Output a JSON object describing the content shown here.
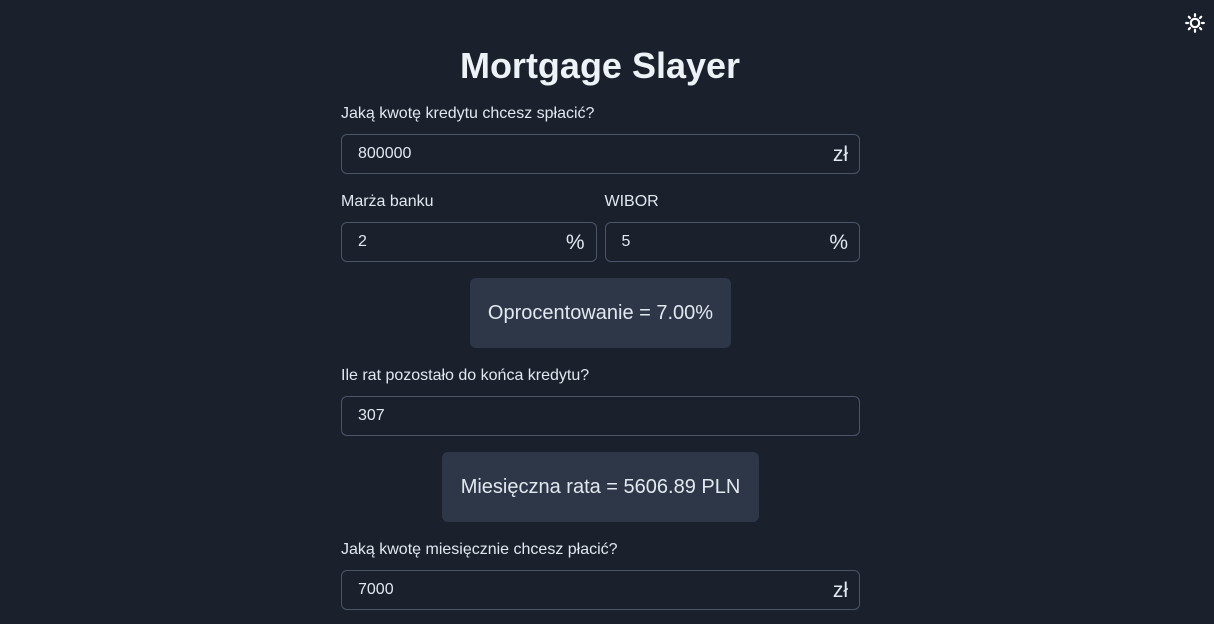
{
  "app": {
    "title": "Mortgage Slayer",
    "theme_toggle_icon": "sun-icon"
  },
  "form": {
    "loan_amount": {
      "label": "Jaką kwotę kredytu chcesz spłacić?",
      "value": "800000",
      "suffix": "zł"
    },
    "bank_margin": {
      "label": "Marża banku",
      "value": "2",
      "suffix": "%"
    },
    "wibor": {
      "label": "WIBOR",
      "value": "5",
      "suffix": "%"
    },
    "interest_result": "Oprocentowanie = 7.00%",
    "remaining_installments": {
      "label": "Ile rat pozostało do końca kredytu?",
      "value": "307"
    },
    "monthly_installment_result": "Miesięczna rata = 5606.89 PLN",
    "monthly_payment": {
      "label": "Jaką kwotę miesięcznie chcesz płacić?",
      "value": "7000",
      "suffix": "zł"
    }
  },
  "colors": {
    "background": "#1a202c",
    "panel": "#2d3748",
    "border": "#4a5568",
    "text": "#e2e8f0"
  }
}
